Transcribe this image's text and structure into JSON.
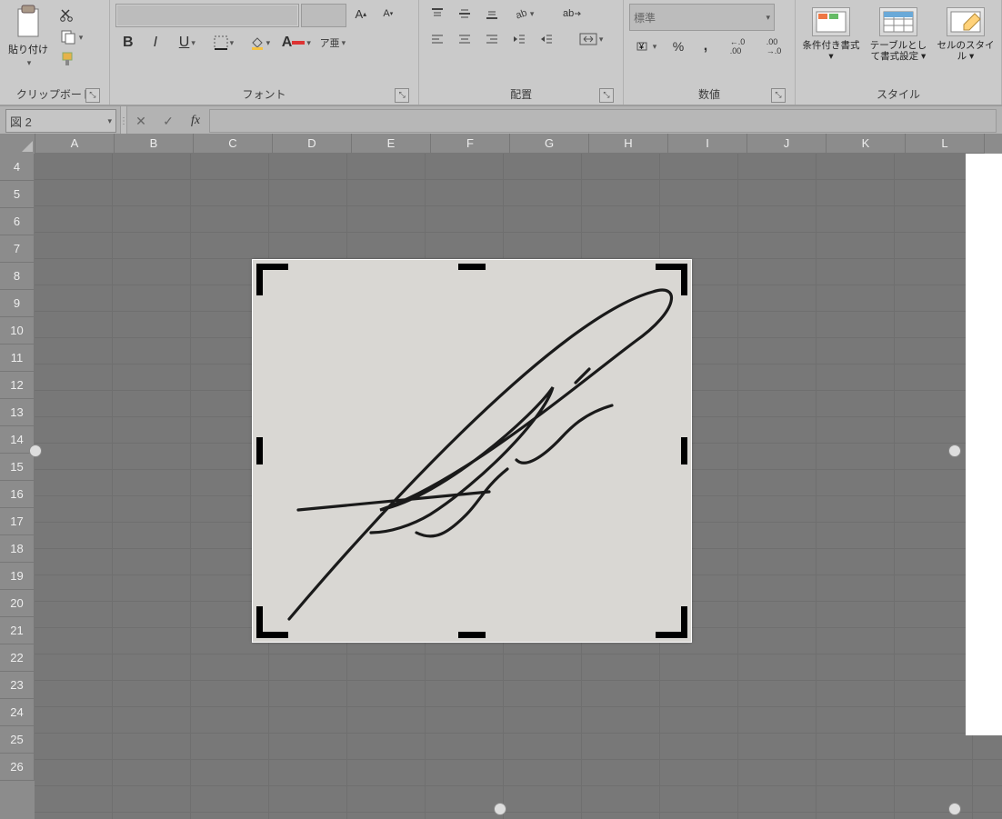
{
  "ribbon": {
    "clipboard": {
      "label": "クリップボード",
      "paste": "貼り付け"
    },
    "font": {
      "label": "フォント",
      "bold": "B",
      "italic": "I",
      "underline": "U",
      "ruby": "ア亜"
    },
    "alignment": {
      "label": "配置",
      "wrap": "ab"
    },
    "number": {
      "label": "数値",
      "format": "標準",
      "percent": "%",
      "comma": ",",
      "inc": ".0 .00",
      "dec": ".00 .0"
    },
    "styles": {
      "label": "スタイル",
      "cond": "条件付き書式 ▾",
      "table": "テーブルとして書式設定 ▾",
      "cell": "セルのスタイル ▾"
    }
  },
  "namebox": "図 2",
  "fx_cancel": "✕",
  "fx_enter": "✓",
  "fx_label": "fx",
  "columns": [
    "A",
    "B",
    "C",
    "D",
    "E",
    "F",
    "G",
    "H",
    "I",
    "J",
    "K",
    "L"
  ],
  "rows": [
    "4",
    "5",
    "6",
    "7",
    "8",
    "9",
    "10",
    "11",
    "12",
    "13",
    "14",
    "15",
    "16",
    "17",
    "18",
    "19",
    "20",
    "21",
    "22",
    "23",
    "24",
    "25",
    "26"
  ]
}
